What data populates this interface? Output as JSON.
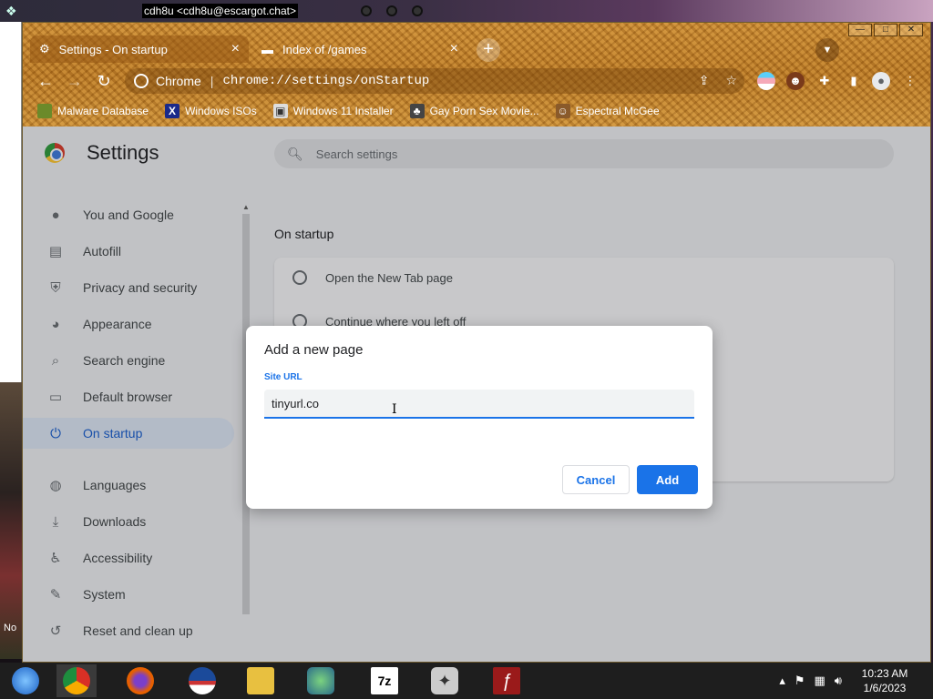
{
  "desktop": {
    "top_window_title": "cdh8u <cdh8u@escargot.chat>",
    "side_text": "No"
  },
  "browser": {
    "window_controls": {
      "minimize": "—",
      "maximize": "□",
      "close": "✕"
    },
    "tabs": [
      {
        "title": "Settings - On startup",
        "icon": "gear-icon",
        "active": true
      },
      {
        "title": "Index of /games",
        "icon": "folder-icon",
        "active": false
      }
    ],
    "new_tab_label": "+",
    "omnibox": {
      "site_name": "Chrome",
      "url": "chrome://settings/onStartup"
    },
    "bookmarks": [
      {
        "label": "Malware Database",
        "icon": "bookmark-icon"
      },
      {
        "label": "Windows ISOs",
        "icon": "x-icon"
      },
      {
        "label": "Windows 11 Installer",
        "icon": "image-icon"
      },
      {
        "label": "Gay Porn Sex Movie...",
        "icon": "bookmark-icon"
      },
      {
        "label": "Espectral McGee",
        "icon": "avatar-icon"
      }
    ]
  },
  "settings": {
    "title": "Settings",
    "search_placeholder": "Search settings",
    "sidebar": [
      {
        "label": "You and Google",
        "icon": "person-icon",
        "active": false
      },
      {
        "label": "Autofill",
        "icon": "clipboard-icon",
        "active": false
      },
      {
        "label": "Privacy and security",
        "icon": "shield-icon",
        "active": false
      },
      {
        "label": "Appearance",
        "icon": "palette-icon",
        "active": false
      },
      {
        "label": "Search engine",
        "icon": "search-icon",
        "active": false
      },
      {
        "label": "Default browser",
        "icon": "browser-icon",
        "active": false
      },
      {
        "label": "On startup",
        "icon": "power-icon",
        "active": true
      },
      {
        "label": "Languages",
        "icon": "globe-icon",
        "active": false
      },
      {
        "label": "Downloads",
        "icon": "download-icon",
        "active": false
      },
      {
        "label": "Accessibility",
        "icon": "accessibility-icon",
        "active": false
      },
      {
        "label": "System",
        "icon": "wrench-icon",
        "active": false
      },
      {
        "label": "Reset and clean up",
        "icon": "history-icon",
        "active": false
      }
    ],
    "section_title": "On startup",
    "options": [
      {
        "label": "Open the New Tab page"
      },
      {
        "label": "Continue where you left off"
      }
    ]
  },
  "dialog": {
    "title": "Add a new page",
    "field_label": "Site URL",
    "field_value": "tinyurl.co",
    "cancel_label": "Cancel",
    "add_label": "Add"
  },
  "taskbar": {
    "apps": [
      {
        "name": "start-orb-icon",
        "color": "#2b6fd6"
      },
      {
        "name": "chrome-icon",
        "color": "#e0b030"
      },
      {
        "name": "firefox-icon",
        "color": "#e66000"
      },
      {
        "name": "obama-logo-icon",
        "color": "#1b4a9a"
      },
      {
        "name": "file-explorer-icon",
        "color": "#e8c040"
      },
      {
        "name": "network-people-icon",
        "color": "#3a9a4a"
      },
      {
        "name": "7zip-icon",
        "color": "#ffffff"
      },
      {
        "name": "gamepad-icon",
        "color": "#bbbbbb"
      },
      {
        "name": "flash-icon",
        "color": "#b02020"
      }
    ],
    "seven_zip_label": "7z",
    "clock_time": "10:23 AM",
    "clock_date": "1/6/2023"
  }
}
